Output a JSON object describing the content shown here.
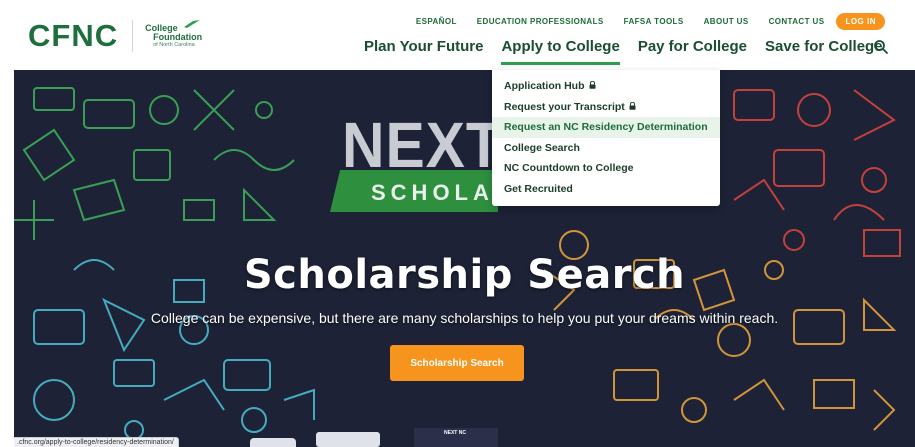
{
  "logo": {
    "mark": "CFNC",
    "line1": "College",
    "line2": "Foundation",
    "line3": "of North Carolina"
  },
  "util_nav": {
    "items": [
      "ESPAÑOL",
      "EDUCATION PROFESSIONALS",
      "FAFSA TOOLS",
      "ABOUT US",
      "CONTACT US"
    ],
    "login": "LOG IN"
  },
  "main_nav": {
    "items": [
      "Plan Your Future",
      "Apply to College",
      "Pay for College",
      "Save for College"
    ],
    "active": "Apply to College"
  },
  "dropdown": {
    "items": [
      {
        "label": "Application Hub",
        "locked": true
      },
      {
        "label": "Request your Transcript",
        "locked": true
      },
      {
        "label": "Request an NC Residency Determination",
        "locked": false,
        "hovered": true
      },
      {
        "label": "College Search",
        "locked": false
      },
      {
        "label": "NC Countdown to College",
        "locked": false
      },
      {
        "label": "Get Recruited",
        "locked": false
      }
    ]
  },
  "hero": {
    "badge_word": "NEXT",
    "ribbon_text": "SCHOLA",
    "title": "Scholarship Search",
    "subtitle": "College can be expensive, but there are many scholarships to help you put your dreams within reach.",
    "button": "Scholarship Search",
    "thumb_label": "NEXT NC"
  },
  "status_bar": {
    "url": ".cfnc.org/apply-to-college/residency-determination/"
  },
  "colors": {
    "brand_green": "#1f6f3e",
    "accent_orange": "#f7941d",
    "hero_bg": "#1d2236",
    "dropdown_hover": "#e8f4ea"
  },
  "icons": [
    "search-icon",
    "lock-icon",
    "logo-swoosh-icon"
  ]
}
